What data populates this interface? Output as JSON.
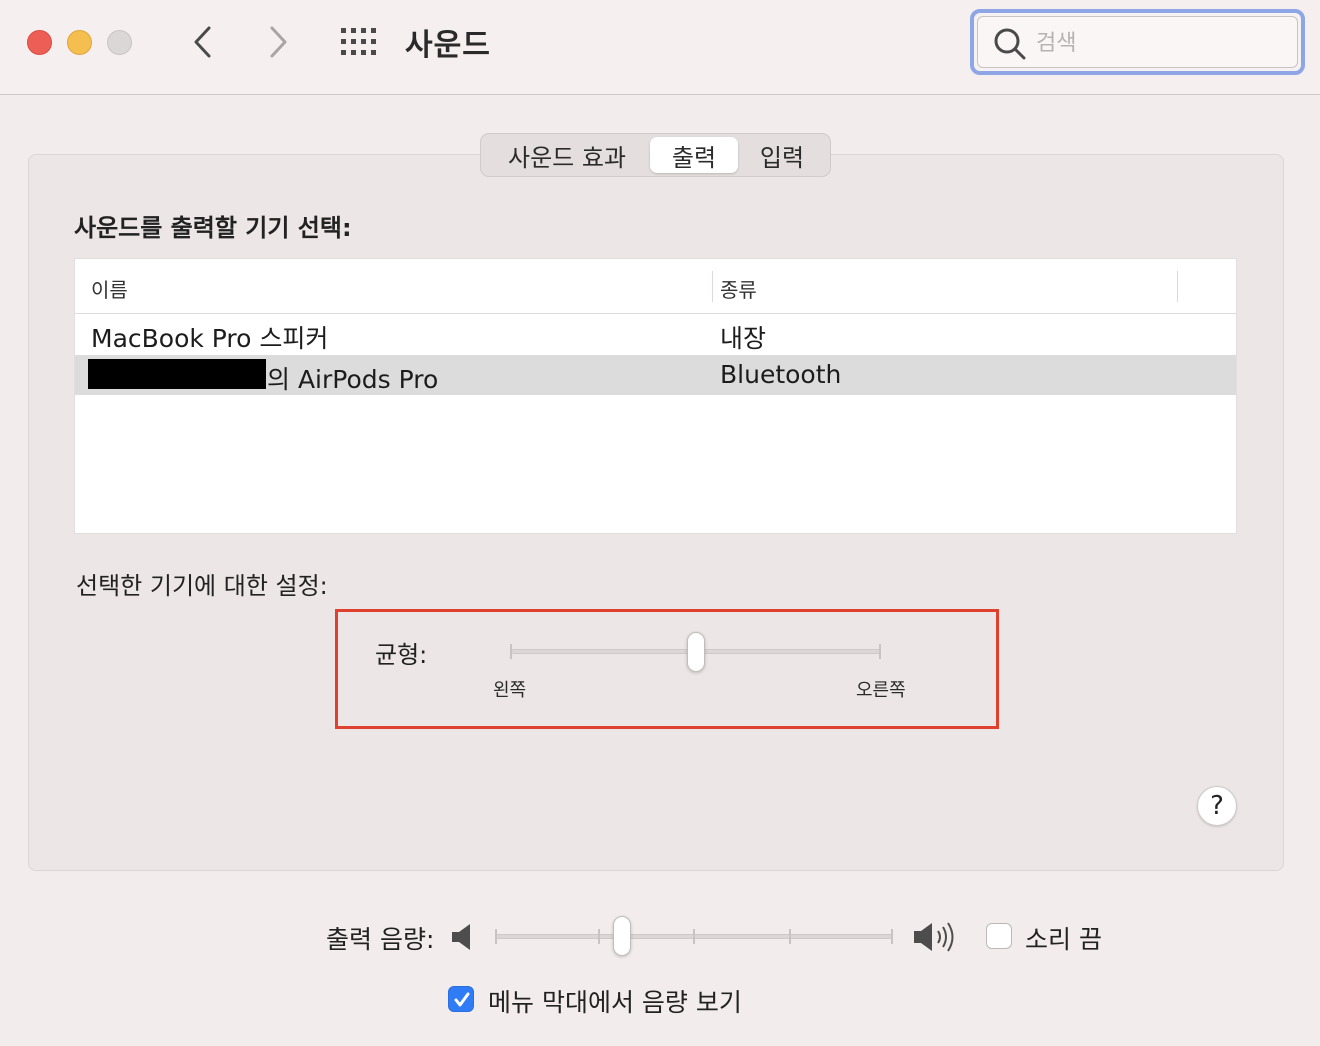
{
  "window": {
    "title": "사운드",
    "search_placeholder": "검색"
  },
  "tabs": [
    {
      "label": "사운드 효과",
      "selected": false
    },
    {
      "label": "출력",
      "selected": true
    },
    {
      "label": "입력",
      "selected": false
    }
  ],
  "output": {
    "section_title": "사운드를 출력할 기기 선택:",
    "columns": {
      "name": "이름",
      "kind": "종류"
    },
    "devices": [
      {
        "name": "MacBook Pro 스피커",
        "kind": "내장",
        "selected": false
      },
      {
        "name": "의 AirPods Pro",
        "kind": "Bluetooth",
        "selected": true,
        "name_partially_redacted": true
      }
    ],
    "settings_title": "선택한 기기에 대한 설정:",
    "balance": {
      "label": "균형:",
      "left_label": "왼쪽",
      "right_label": "오른쪽",
      "value": 0.5
    }
  },
  "help_label": "?",
  "volume": {
    "label": "출력 음량:",
    "value": 0.32,
    "mute_label": "소리 끔",
    "mute_checked": false,
    "show_in_menubar_label": "메뉴 막대에서 음량 보기",
    "show_in_menubar_checked": true
  },
  "colors": {
    "accent": "#2f7cf6",
    "highlight": "#e0412f",
    "close": "#ed5f56",
    "minimize": "#f5bf4f"
  }
}
